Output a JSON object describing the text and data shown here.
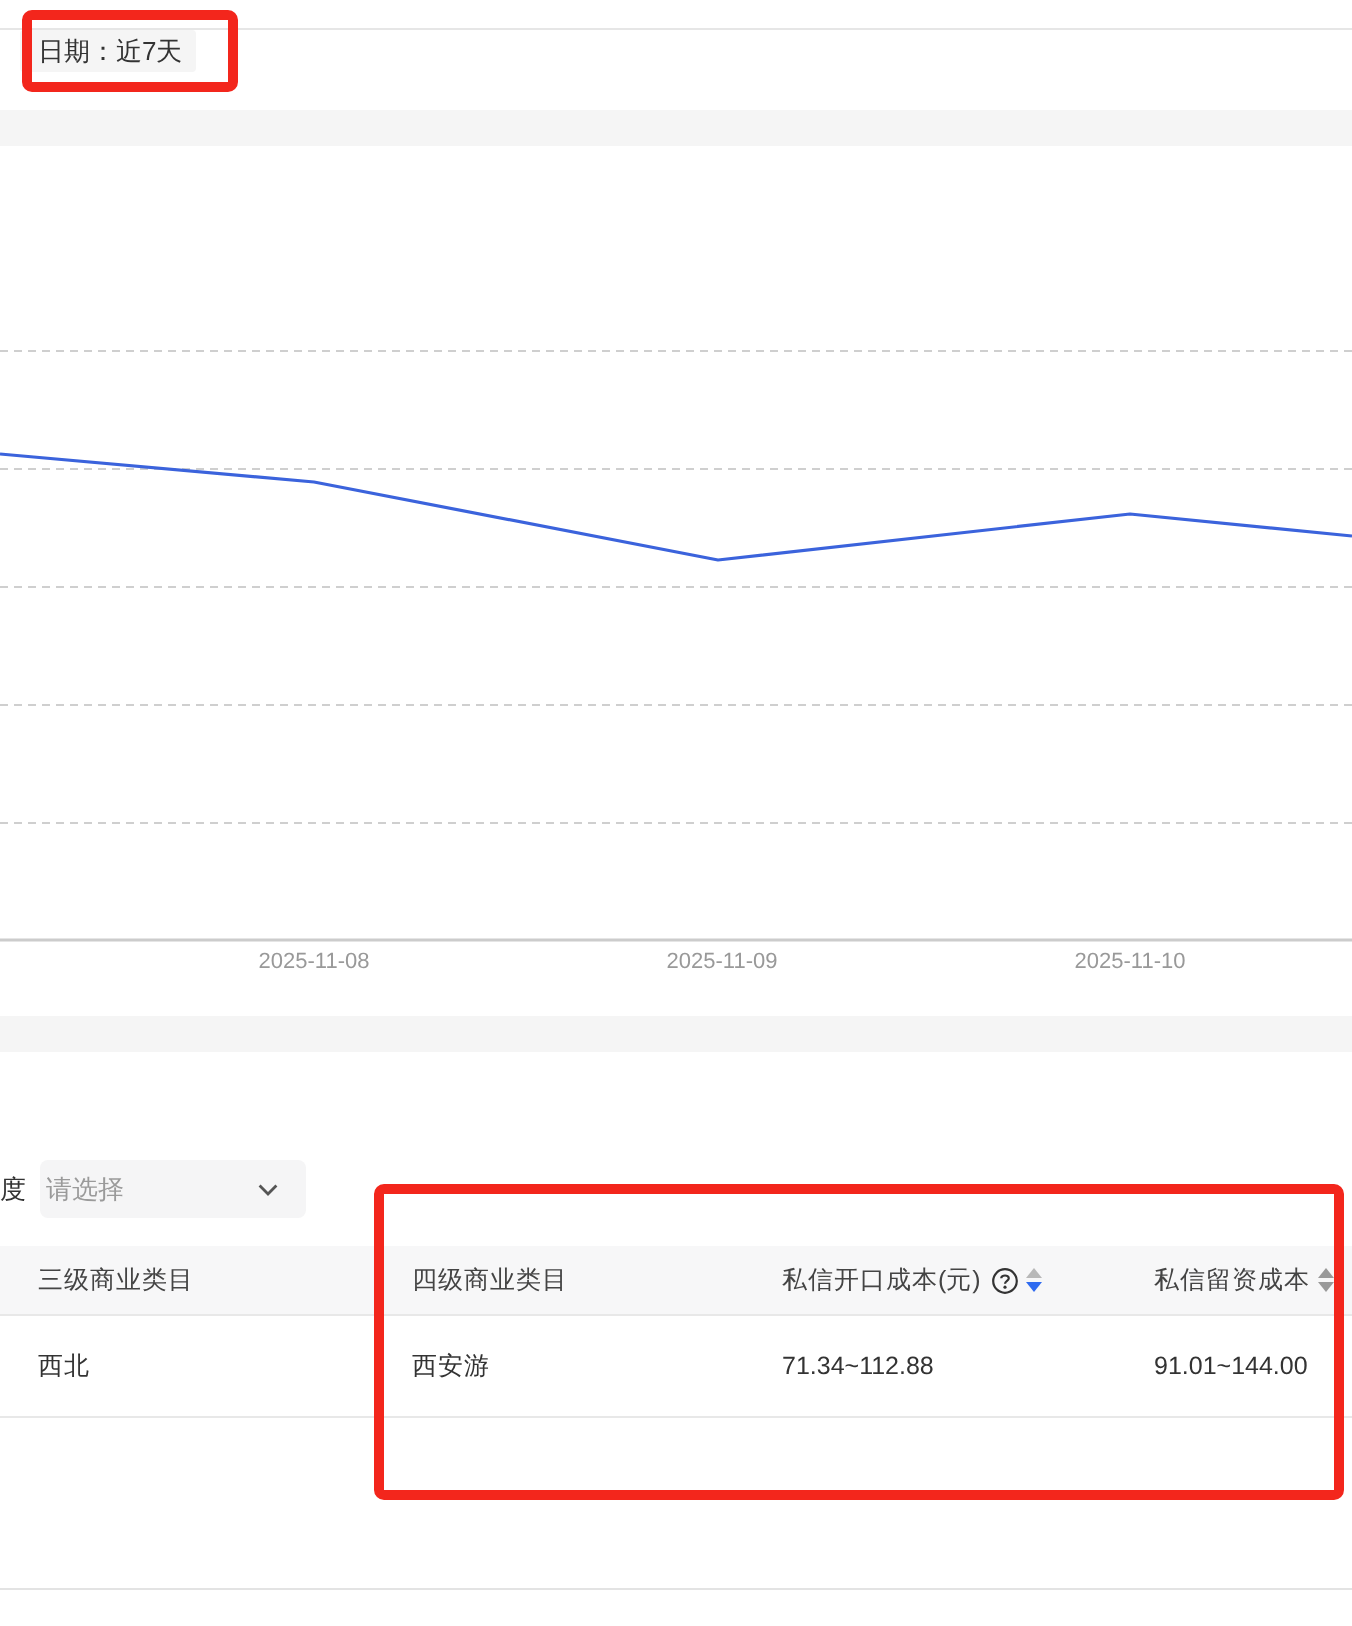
{
  "date_filter": {
    "label": "日期：近7天",
    "highlighted": true
  },
  "chart": {
    "x_labels": [
      "2025-11-08",
      "2025-11-09",
      "2025-11-10"
    ]
  },
  "filter": {
    "label": "度",
    "placeholder": "请选择"
  },
  "table": {
    "columns": [
      {
        "title": "三级商业类目",
        "help": false,
        "sortable": false,
        "sorted": false,
        "highlighted": false
      },
      {
        "title": "四级商业类目",
        "help": false,
        "sortable": false,
        "sorted": false,
        "highlighted": true
      },
      {
        "title": "私信开口成本(元)",
        "help": true,
        "sortable": true,
        "sorted": true,
        "highlighted": true
      },
      {
        "title": "私信留资成本",
        "help": false,
        "sortable": true,
        "sorted": false,
        "highlighted": true
      }
    ],
    "rows": [
      [
        "西北",
        "西安游",
        "71.34~112.88",
        "91.01~144.00"
      ]
    ]
  }
}
